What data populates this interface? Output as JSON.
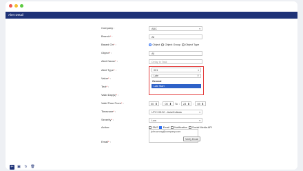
{
  "header": {
    "title": "Alert Detail"
  },
  "form": {
    "company": {
      "label": "Company",
      "value": "ABC"
    },
    "branch": {
      "label": "Branch",
      "value": "All"
    },
    "based_on": {
      "label": "Based On",
      "options": [
        "Object",
        "Object Group",
        "Object Type"
      ],
      "selected": "Object"
    },
    "object": {
      "label": "Object",
      "value": "All"
    },
    "alert_name": {
      "label": "Alert Name",
      "value": "Delay in Task"
    },
    "alert_type": {
      "label": "Alert Type",
      "value": "001",
      "search_value": "Late",
      "group": "General",
      "option": "Late Start"
    },
    "value": {
      "label": "Value"
    },
    "text": {
      "label": "Text"
    },
    "valid_days": {
      "label": "Valid Day(s)"
    },
    "valid_time": {
      "label": "Valid Time From",
      "from_h": "00",
      "from_m": "00",
      "to_label": "To",
      "to_h": "23",
      "to_m": "59"
    },
    "timezone": {
      "label": "Timezone",
      "value": "UTC+05:30 - Asia/Kolkata"
    },
    "severity": {
      "label": "Severity",
      "value": "Low"
    },
    "action": {
      "label": "Action",
      "options": [
        "SMS",
        "Email",
        "Notification",
        "Social Media API"
      ],
      "checked": "Email"
    },
    "email": {
      "label": "Email",
      "value": "john.wrong@company.com",
      "verify_label": "Verify Email"
    }
  },
  "colors": {
    "header": "#1e3277",
    "accent": "#2e62c8",
    "highlight": "#e43d3d"
  },
  "bottombar": {
    "icons": [
      "back-icon",
      "save-icon",
      "refresh-icon",
      "delete-icon"
    ]
  }
}
